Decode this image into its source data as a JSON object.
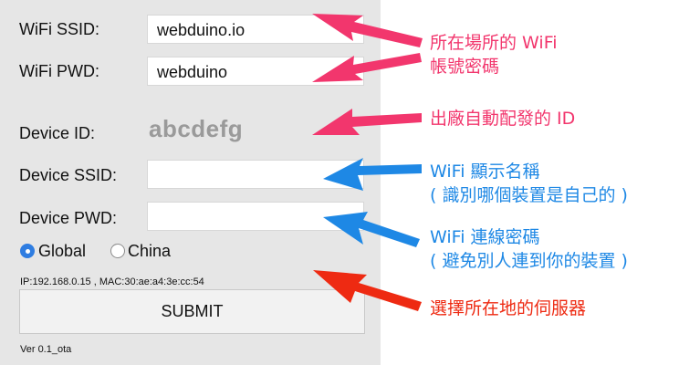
{
  "form": {
    "wifi_ssid": {
      "label": "WiFi SSID:",
      "value": "webduino.io"
    },
    "wifi_pwd": {
      "label": "WiFi PWD:",
      "value": "webduino"
    },
    "device_id": {
      "label": "Device ID:",
      "value": "abcdefg"
    },
    "device_ssid": {
      "label": "Device SSID:",
      "value": ""
    },
    "device_pwd": {
      "label": "Device PWD:",
      "value": ""
    },
    "region": {
      "options": [
        {
          "label": "Global",
          "checked": true
        },
        {
          "label": "China",
          "checked": false
        }
      ]
    },
    "ip_line": "IP:192.168.0.15 , MAC:30:ae:a4:3e:cc:54",
    "submit_label": "SUBMIT",
    "version": "Ver 0.1_ota"
  },
  "annotations": {
    "wifi_note_line1": "所在場所的 WiFi",
    "wifi_note_line2": "帳號密碼",
    "device_id_note": "出廠自動配發的 ID",
    "device_ssid_note_line1": "WiFi 顯示名稱",
    "device_ssid_note_line2": "( 識別哪個裝置是自己的 )",
    "device_pwd_note_line1": "WiFi 連線密碼",
    "device_pwd_note_line2": "( 避免別人連到你的裝置 )",
    "region_note": "選擇所在地的伺服器"
  },
  "colors": {
    "pink_arrow": "#f2366d",
    "blue_arrow": "#1e88e5",
    "red_arrow": "#ee2a12",
    "panel_bg": "#e6e6e6",
    "device_id_text": "#9a9a9a",
    "radio_checked": "#2f7de1"
  }
}
